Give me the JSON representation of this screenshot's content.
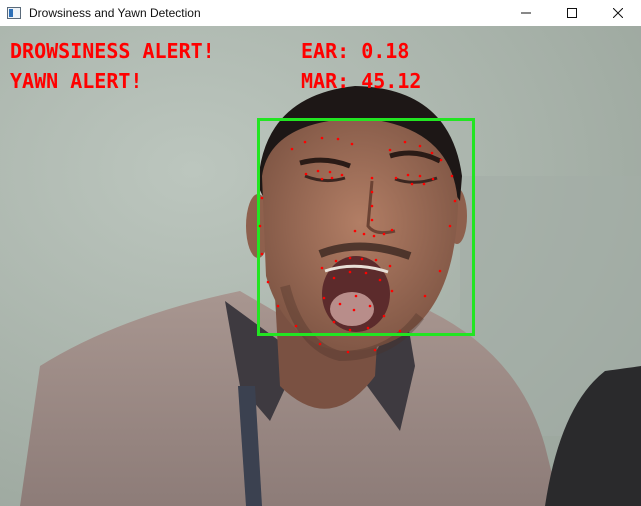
{
  "window": {
    "title": "Drowsiness and Yawn Detection",
    "controls": {
      "minimize_icon": "minimize-icon",
      "maximize_icon": "maximize-icon",
      "close_icon": "close-icon"
    }
  },
  "overlay": {
    "drowsiness_alert": "DROWSINESS ALERT!",
    "yawn_alert": "YAWN ALERT!",
    "ear": "EAR: 0.18",
    "mar": "MAR: 45.12"
  },
  "colors": {
    "alert_text": "#ff0000",
    "face_box": "#22e522",
    "landmarks": "#ff0000",
    "titlebar": "#ffffff"
  },
  "video": {
    "subject": "webcam frame of a person yawning with face box and facial landmarks"
  }
}
